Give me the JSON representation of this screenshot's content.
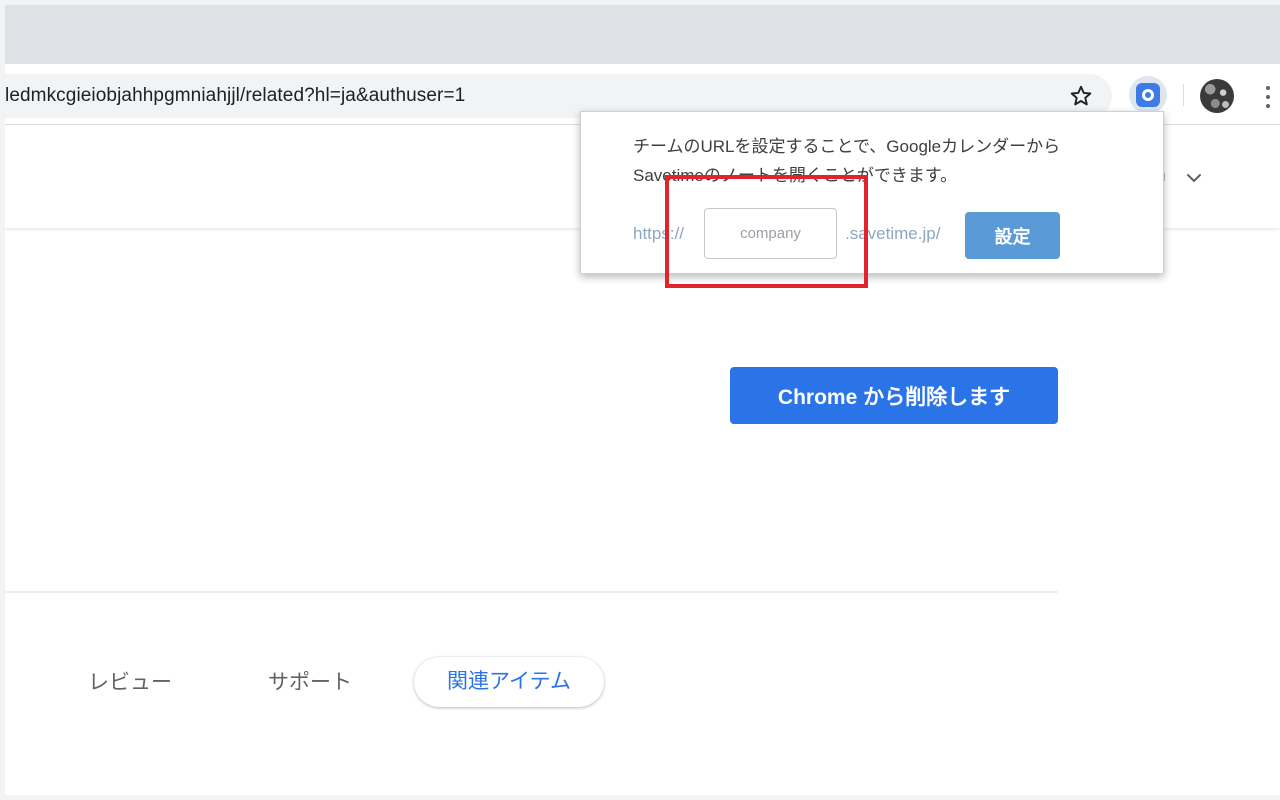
{
  "browser": {
    "url": "ledmkcgieiobjahhpgmniahjjl/related?hl=ja&authuser=1",
    "icons": {
      "bookmark": "star-outline-icon",
      "extension": "savetime-extension-icon",
      "profile": "profile-avatar",
      "menu": "more-vert-icon"
    }
  },
  "header": {
    "account_fragment": "n"
  },
  "main": {
    "remove_button": "Chrome から削除します"
  },
  "tabs": [
    {
      "label": "レビュー",
      "active": false
    },
    {
      "label": "サポート",
      "active": false
    },
    {
      "label": "関連アイテム",
      "active": true
    }
  ],
  "popup": {
    "message_line1": "チームのURLを設定することで、Googleカレンダーから",
    "message_line2": "Savetimeのノートを開くことができます。",
    "prefix": "https://",
    "input_placeholder": "company",
    "suffix": ".savetime.jp/",
    "button": "設定"
  },
  "colors": {
    "primary_button": "#2b74e8",
    "popup_button": "#5a9ad7",
    "highlight": "#e0242a",
    "link_text": "#8fa6c1"
  }
}
